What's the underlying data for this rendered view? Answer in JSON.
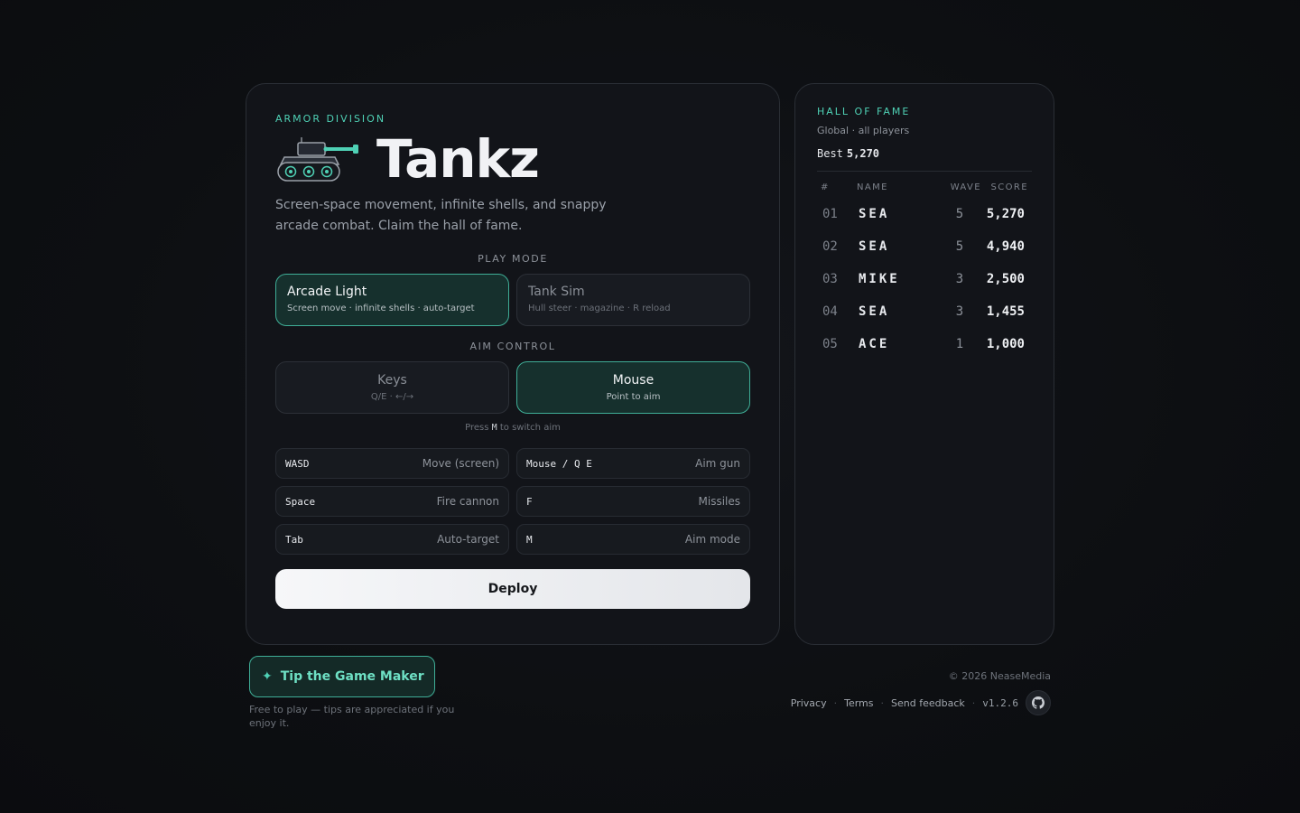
{
  "header": {
    "eyebrow": "ARMOR DIVISION",
    "title": "Tankz",
    "subtitle": "Screen-space movement, infinite shells, and snappy arcade combat. Claim the hall of fame."
  },
  "play_mode": {
    "label": "PLAY MODE",
    "options": [
      {
        "title": "Arcade Light",
        "sub": "Screen move · infinite shells · auto-target",
        "selected": true
      },
      {
        "title": "Tank Sim",
        "sub": "Hull steer · magazine · R reload",
        "selected": false
      }
    ]
  },
  "aim_control": {
    "label": "AIM CONTROL",
    "options": [
      {
        "title": "Keys",
        "sub": "Q/E · ←/→",
        "selected": false
      },
      {
        "title": "Mouse",
        "sub": "Point to aim",
        "selected": true
      }
    ],
    "hint_pre": "Press",
    "hint_key": "M",
    "hint_post": "to switch aim"
  },
  "controls": [
    {
      "key": "WASD",
      "action": "Move (screen)"
    },
    {
      "key": "Mouse / Q E",
      "action": "Aim gun"
    },
    {
      "key": "Space",
      "action": "Fire cannon"
    },
    {
      "key": "F",
      "action": "Missiles"
    },
    {
      "key": "Tab",
      "action": "Auto-target"
    },
    {
      "key": "M",
      "action": "Aim mode"
    }
  ],
  "deploy_label": "Deploy",
  "hall_of_fame": {
    "title": "HALL OF FAME",
    "sub": "Global · all players",
    "best_label": "Best",
    "best_value": "5,270",
    "columns": {
      "rank": "#",
      "name": "NAME",
      "wave": "WAVE",
      "score": "SCORE"
    },
    "rows": [
      {
        "rank": "01",
        "name": "SEA",
        "wave": "5",
        "score": "5,270"
      },
      {
        "rank": "02",
        "name": "SEA",
        "wave": "5",
        "score": "4,940"
      },
      {
        "rank": "03",
        "name": "MIKE",
        "wave": "3",
        "score": "2,500"
      },
      {
        "rank": "04",
        "name": "SEA",
        "wave": "3",
        "score": "1,455"
      },
      {
        "rank": "05",
        "name": "ACE",
        "wave": "1",
        "score": "1,000"
      }
    ]
  },
  "footer": {
    "tip_icon": "✦",
    "tip_label": "Tip the Game Maker",
    "tip_note": "Free to play — tips are appreciated if you enjoy it.",
    "copyright": "© 2026 NeaseMedia",
    "links": [
      "Privacy",
      "Terms",
      "Send feedback"
    ],
    "version": "v1.2.6"
  },
  "colors": {
    "accent": "#4fd1b5",
    "background": "#0d0f12",
    "card": "#121419"
  }
}
